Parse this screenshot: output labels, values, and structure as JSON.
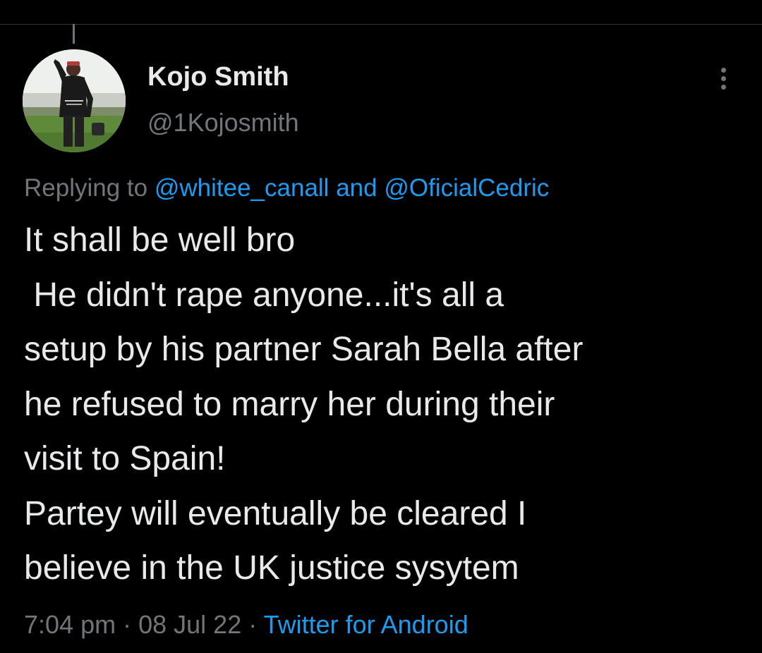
{
  "tweet": {
    "author": {
      "display_name": "Kojo Smith",
      "handle": "@1Kojosmith",
      "avatar_icon": "profile-photo"
    },
    "more_icon": "more-vertical-icon",
    "replying": {
      "prefix": "Replying to",
      "mention_1": "@whitee_canall",
      "conjunction": "and",
      "mention_2": "@OficialCedric"
    },
    "text_lines": [
      "It shall be well bro",
      " He didn't rape anyone...it's all a",
      "setup by his partner Sarah Bella after",
      "he refused to marry her during their",
      "visit to Spain!",
      "Partey will eventually be cleared I",
      "believe in the UK justice sysytem"
    ],
    "meta": {
      "time": "7:04 pm",
      "separator": "·",
      "date": "08 Jul 22",
      "source": "Twitter for Android"
    }
  },
  "colors": {
    "background": "#000000",
    "text_primary": "#e7e9ea",
    "text_secondary": "#71767b",
    "link": "#1d9bf0"
  }
}
